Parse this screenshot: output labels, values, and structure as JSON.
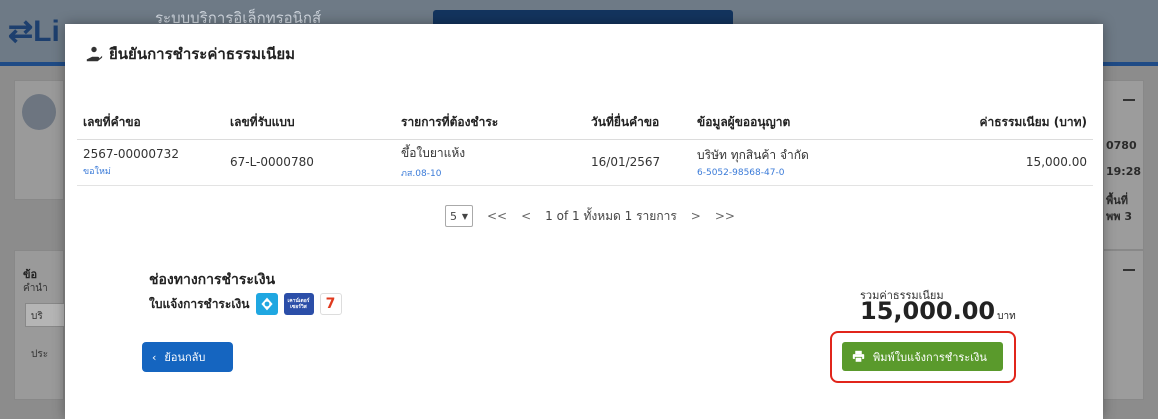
{
  "background": {
    "logo": "Li",
    "topbar_title": "ระบบบริการอิเล็กทรอนิกส์",
    "right_lines": [
      "0780",
      "19:28",
      "พื้นที่",
      "พพ 3"
    ],
    "left_card_title": "ข้อ",
    "left_card_label": "คำนำ",
    "left_card_input": "บริ",
    "left_card_text": "ประ"
  },
  "modal": {
    "title": "ยืนยันการชำระค่าธรรมเนียม",
    "table": {
      "headers": [
        "เลขที่คำขอ",
        "เลขที่รับแบบ",
        "รายการที่ต้องชำระ",
        "วันที่ยื่นคำขอ",
        "ข้อมูลผู้ขออนุญาต",
        "ค่าธรรมเนียม (บาท)"
      ],
      "rows": [
        {
          "request_no": "2567-00000732",
          "request_type": "ขอใหม่",
          "receive_no": "67-L-0000780",
          "item": "ขึ้อใบยาแห้ง",
          "item_code": "ภส.08-10",
          "date": "16/01/2567",
          "applicant": "บริษัท ทุกสินค้า จำกัด",
          "applicant_id": "6-5052-98568-47-0",
          "fee": "15,000.00"
        }
      ]
    },
    "pagination": {
      "page_size": "5",
      "first": "<<",
      "prev": "<",
      "info": "1 of 1 ทั้งหมด 1 รายการ",
      "next": ">",
      "last": ">>"
    },
    "payment": {
      "title": "ช่องทางการชำระเงิน",
      "subtitle": "ใบแจ้งการชำระเงิน",
      "counter_logo_text": "เคาน์เตอร์ เซอร์วิส"
    },
    "total": {
      "label": "รวมค่าธรรมเนียม",
      "amount": "15,000.00",
      "unit": "บาท"
    },
    "buttons": {
      "back": "ย้อนกลับ",
      "print": "พิมพ์ใบแจ้งการชำระเงิน"
    }
  },
  "colors": {
    "back_button": "#1565c0",
    "print_button": "#5a9a2c",
    "highlight": "#e1251b",
    "link": "#3b7bd8"
  }
}
